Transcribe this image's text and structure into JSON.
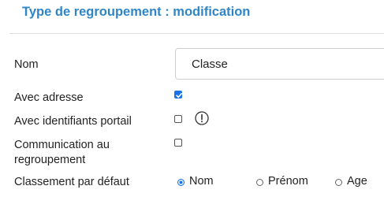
{
  "header": {
    "title": "Type de regroupement : modification"
  },
  "fields": {
    "nom": {
      "label": "Nom",
      "value": "Classe"
    },
    "avec_adresse": {
      "label": "Avec adresse",
      "checked": true
    },
    "avec_identifiants": {
      "label": "Avec identifiants portail",
      "checked": false,
      "icon": "info-icon"
    },
    "communication": {
      "label_line1": "Communication au",
      "label_line2": "regroupement",
      "checked": false
    },
    "classement": {
      "label": "Classement par défaut",
      "options": [
        "Nom",
        "Prénom",
        "Age"
      ],
      "selected": "Nom"
    }
  },
  "colors": {
    "title": "#2f86c7",
    "accent": "#1a73e8"
  }
}
